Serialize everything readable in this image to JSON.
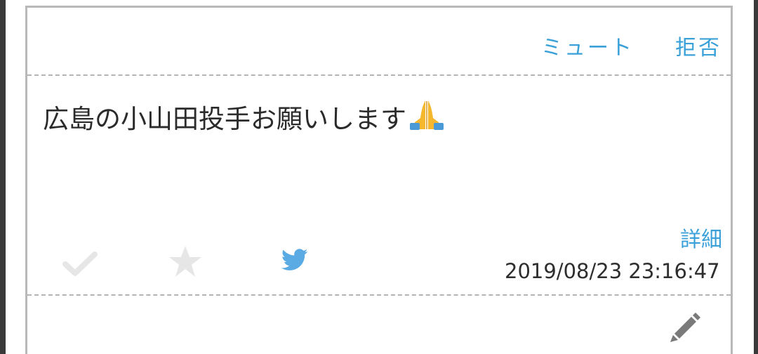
{
  "header": {
    "mute_label": "ミュート",
    "reject_label": "拒否"
  },
  "post": {
    "message": "広島の小山田投手お願いします",
    "detail_label": "詳細",
    "timestamp": "2019/08/23 23:16:47"
  },
  "icons": {
    "check": "check-icon",
    "star": "star-icon",
    "twitter": "twitter-icon",
    "edit": "pencil-icon",
    "pray": "folded-hands-emoji"
  },
  "colors": {
    "accent": "#3aa0d8",
    "icon_inactive": "#e6e6e6",
    "twitter_blue": "#5aaae3",
    "pencil": "#7a7a7a",
    "text": "#2b2b2b"
  }
}
